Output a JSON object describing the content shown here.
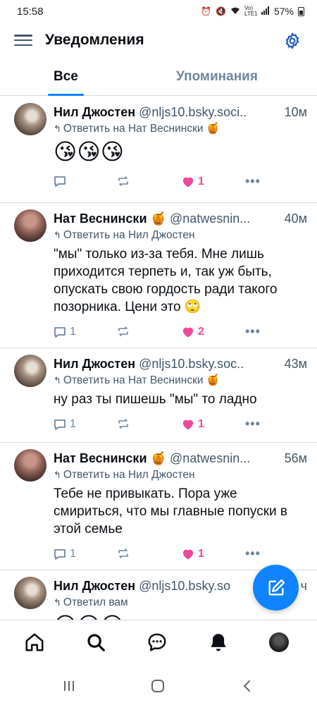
{
  "status_bar": {
    "time": "15:58",
    "icons": [
      "alarm-icon",
      "mute-icon",
      "wifi-icon",
      "volte-icon",
      "signal-icon"
    ],
    "network_label": "Vo) LTE1",
    "battery": "57%"
  },
  "header": {
    "title": "Уведомления"
  },
  "tabs": [
    {
      "label": "Все",
      "active": true
    },
    {
      "label": "Упоминания",
      "active": false
    }
  ],
  "posts": [
    {
      "author": "Нил Джостен",
      "handle": "@nljs10.bsky.soci..",
      "time": "10м",
      "reply": "Ответить на Нат Веснински 🍯",
      "text": "",
      "emojis": "😘😘😘",
      "replies": "",
      "likes": "1",
      "avatar": "neil"
    },
    {
      "author": "Нат Веснински 🍯",
      "handle": "@natwesnin...",
      "time": "40м",
      "reply": "Ответить на Нил Джостен",
      "text": "\"мы\" только из-за тебя. Мне лишь приходится терпеть и, так уж быть, опускать свою гордость ради такого позорника. Цени это 🙄",
      "emojis": "",
      "replies": "1",
      "likes": "2",
      "avatar": "nat"
    },
    {
      "author": "Нил Джостен",
      "handle": "@nljs10.bsky.soc..",
      "time": "43м",
      "reply": "Ответить на Нат Веснински 🍯",
      "text": "ну раз ты пишешь \"мы\" то ладно",
      "emojis": "",
      "replies": "1",
      "likes": "1",
      "avatar": "neil"
    },
    {
      "author": "Нат Веснински 🍯",
      "handle": "@natwesnin...",
      "time": "56м",
      "reply": "Ответить на Нил Джостен",
      "text": "Тебе не привыкать. Пора уже смириться, что мы главные попуски в этой семье",
      "emojis": "",
      "replies": "1",
      "likes": "1",
      "avatar": "nat"
    },
    {
      "author": "Нил Джостен",
      "handle": "@nljs10.bsky.so",
      "time": "ч",
      "reply": "Ответил вам",
      "text": "",
      "emojis": "😘😘😘",
      "replies": "",
      "likes": "",
      "avatar": "neil"
    }
  ],
  "colors": {
    "accent": "#1083fe",
    "like": "#ec4899",
    "muted": "#6f869f",
    "divider": "#d4dbe2"
  },
  "bottom_nav": [
    "home-icon",
    "search-icon",
    "messages-icon",
    "notifications-icon",
    "profile-avatar"
  ]
}
